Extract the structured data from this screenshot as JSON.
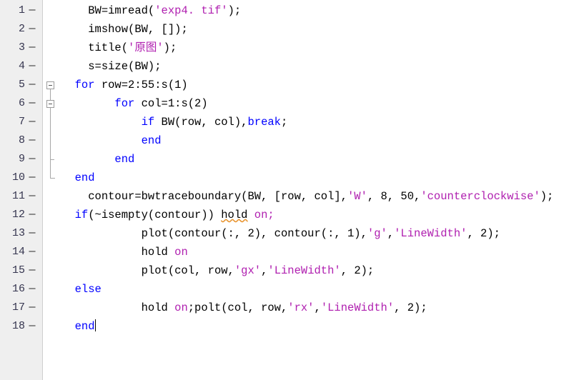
{
  "editor": {
    "app": "matlab-code-editor",
    "language": "MATLAB",
    "colors": {
      "background": "#ffffff",
      "gutter_background": "#efefef",
      "gutter_border": "#cfcfcf",
      "line_number": "#35354f",
      "keyword": "#0000ff",
      "string": "#b020b0",
      "plain": "#000000",
      "warning_underline": "#e8922a",
      "fold_guide": "#a8a8a8"
    },
    "total_lines": 18,
    "cursor": {
      "line": 18,
      "column": 12
    }
  },
  "gutter": {
    "executable_marker": "—",
    "line_numbers": [
      "1",
      "2",
      "3",
      "4",
      "5",
      "6",
      "7",
      "8",
      "9",
      "10",
      "11",
      "12",
      "13",
      "14",
      "15",
      "16",
      "17",
      "18"
    ]
  },
  "fold_markers": [
    {
      "line": 5,
      "state": "expanded",
      "glyph": "minus-box"
    },
    {
      "line": 6,
      "state": "expanded",
      "glyph": "minus-box"
    }
  ],
  "lines": [
    {
      "number": "1",
      "indent": 4,
      "tokens": [
        {
          "t": "BW=imread(",
          "k": "pln"
        },
        {
          "t": "'exp4. tif'",
          "k": "str"
        },
        {
          "t": ");",
          "k": "pln"
        }
      ]
    },
    {
      "number": "2",
      "indent": 4,
      "tokens": [
        {
          "t": "imshow(BW, []);",
          "k": "pln"
        }
      ]
    },
    {
      "number": "3",
      "indent": 4,
      "tokens": [
        {
          "t": "title(",
          "k": "pln"
        },
        {
          "t": "'原图'",
          "k": "str"
        },
        {
          "t": ");",
          "k": "pln"
        }
      ]
    },
    {
      "number": "4",
      "indent": 4,
      "tokens": [
        {
          "t": "s=size(BW);",
          "k": "pln"
        }
      ]
    },
    {
      "number": "5",
      "indent": 2,
      "tokens": [
        {
          "t": "for",
          "k": "kw"
        },
        {
          "t": " row=2:55:s(1)",
          "k": "pln"
        }
      ]
    },
    {
      "number": "6",
      "indent": 8,
      "tokens": [
        {
          "t": "for",
          "k": "kw"
        },
        {
          "t": " col=1:s(2)",
          "k": "pln"
        }
      ]
    },
    {
      "number": "7",
      "indent": 12,
      "tokens": [
        {
          "t": "if",
          "k": "kw"
        },
        {
          "t": " BW(row, col),",
          "k": "pln"
        },
        {
          "t": "break",
          "k": "kw"
        },
        {
          "t": ";",
          "k": "pln"
        }
      ]
    },
    {
      "number": "8",
      "indent": 12,
      "tokens": [
        {
          "t": "end",
          "k": "kw"
        }
      ]
    },
    {
      "number": "9",
      "indent": 8,
      "tokens": [
        {
          "t": "end",
          "k": "kw"
        }
      ]
    },
    {
      "number": "10",
      "indent": 2,
      "tokens": [
        {
          "t": "end",
          "k": "kw"
        }
      ]
    },
    {
      "number": "11",
      "indent": 4,
      "tokens": [
        {
          "t": "contour=bwtraceboundary(BW, [row, col],",
          "k": "pln"
        },
        {
          "t": "'W'",
          "k": "str"
        },
        {
          "t": ", 8, 50,",
          "k": "pln"
        },
        {
          "t": "'counterclockwise'",
          "k": "str"
        },
        {
          "t": ");",
          "k": "pln"
        }
      ]
    },
    {
      "number": "12",
      "indent": 2,
      "tokens": [
        {
          "t": "if",
          "k": "kw"
        },
        {
          "t": "(~isempty(contour)) ",
          "k": "pln"
        },
        {
          "t": "hold",
          "k": "warn"
        },
        {
          "t": " ",
          "k": "pln"
        },
        {
          "t": "on;",
          "k": "str"
        }
      ]
    },
    {
      "number": "13",
      "indent": 12,
      "tokens": [
        {
          "t": "plot(contour(:, 2), contour(:, 1),",
          "k": "pln"
        },
        {
          "t": "'g'",
          "k": "str"
        },
        {
          "t": ",",
          "k": "pln"
        },
        {
          "t": "'LineWidth'",
          "k": "str"
        },
        {
          "t": ", 2);",
          "k": "pln"
        }
      ]
    },
    {
      "number": "14",
      "indent": 12,
      "tokens": [
        {
          "t": "hold ",
          "k": "pln"
        },
        {
          "t": "on",
          "k": "str"
        }
      ]
    },
    {
      "number": "15",
      "indent": 12,
      "tokens": [
        {
          "t": "plot(col, row,",
          "k": "pln"
        },
        {
          "t": "'gx'",
          "k": "str"
        },
        {
          "t": ",",
          "k": "pln"
        },
        {
          "t": "'LineWidth'",
          "k": "str"
        },
        {
          "t": ", 2);",
          "k": "pln"
        }
      ]
    },
    {
      "number": "16",
      "indent": 2,
      "tokens": [
        {
          "t": "else",
          "k": "kw"
        }
      ]
    },
    {
      "number": "17",
      "indent": 12,
      "tokens": [
        {
          "t": "hold ",
          "k": "pln"
        },
        {
          "t": "on",
          "k": "str"
        },
        {
          "t": ";polt(col, row,",
          "k": "pln"
        },
        {
          "t": "'rx'",
          "k": "str"
        },
        {
          "t": ",",
          "k": "pln"
        },
        {
          "t": "'LineWidth'",
          "k": "str"
        },
        {
          "t": ", 2);",
          "k": "pln"
        }
      ]
    },
    {
      "number": "18",
      "indent": 2,
      "tokens": [
        {
          "t": "end",
          "k": "kw"
        }
      ],
      "cursor_after": true
    }
  ]
}
